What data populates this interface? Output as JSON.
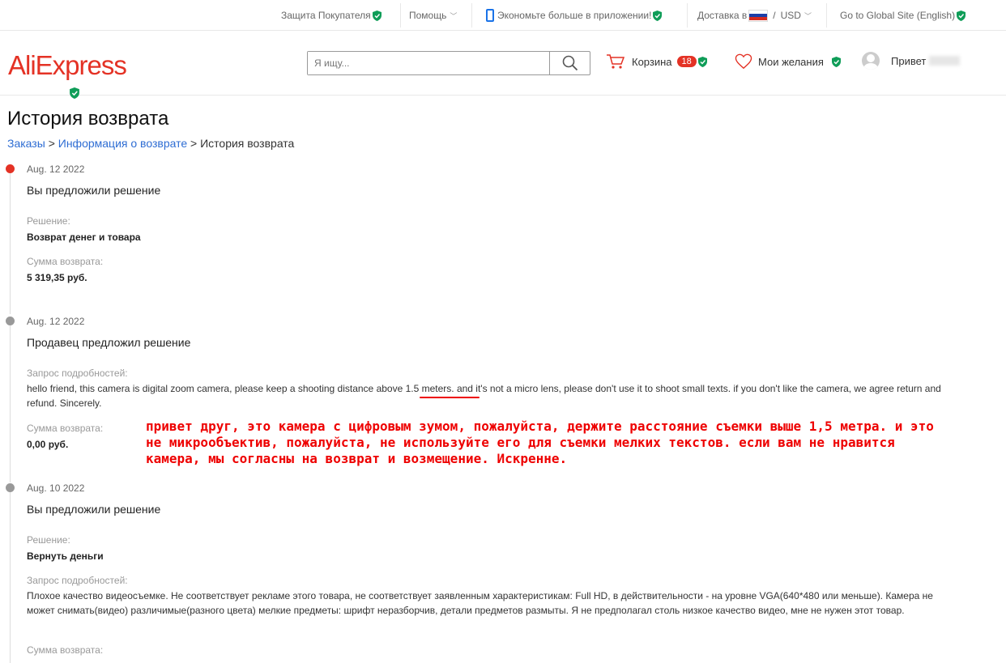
{
  "topbar": {
    "buyer_protection": "Защита Покупателя",
    "help": "Помощь",
    "app_promo": "Экономьте больше в приложении!",
    "ship_to": "Доставка в",
    "currency": "USD",
    "global_site": "Go to Global Site (English)"
  },
  "header": {
    "logo": "AliExpress",
    "search_placeholder": "Я ищу...",
    "cart_label": "Корзина",
    "cart_count": "18",
    "wishlist_label": "Мои желания",
    "greeting": "Привет"
  },
  "page": {
    "title": "История возврата",
    "breadcrumb": [
      "Заказы",
      "Информация о возврате",
      "История возврата"
    ],
    "breadcrumb_sep": ">"
  },
  "timeline": [
    {
      "date": "Aug. 12 2022",
      "heading": "Вы предложили решение",
      "solution_label": "Решение:",
      "solution_value": "Возврат денег и товара",
      "amount_label": "Сумма возврата:",
      "amount_value": "5 319,35 руб."
    },
    {
      "date": "Aug. 12 2022",
      "heading": "Продавец предложил решение",
      "details_label": "Запрос подробностей:",
      "details_text": "hello friend, this camera is digital zoom camera, please keep a shooting distance above 1.5 meters. and it's not a micro lens, please don't use it to shoot small texts. if you don't like the camera, we agree return and refund. Sincerely.",
      "amount_label": "Сумма возврата:",
      "amount_value": "0,00 руб."
    },
    {
      "date": "Aug. 10 2022",
      "heading": "Вы предложили решение",
      "solution_label": "Решение:",
      "solution_value": "Вернуть деньги",
      "details_label": "Запрос подробностей:",
      "details_text": "Плохое качество видеосъемке. Не соответствует рекламе этого товара, не соответствует заявленным характеристикам: Full HD, в действительности - на уровне VGA(640*480 или меньше). Камера не может снимать(видео) различимые(разного цвета) мелкие предметы: шрифт неразборчив, детали предметов размыты. Я не предполагал столь низкое качество видео, мне не нужен этот товар.",
      "amount_label": "Сумма возврата:"
    }
  ],
  "translation_overlay": "привет друг, это камера с цифровым зумом, пожалуйста, держите расстояние съемки выше 1,5 метра. и это не микрообъектив, пожалуйста, не используйте его для съемки мелких текстов. если вам не нравится камера, мы согласны на возврат и возмещение. Искренне.",
  "colors": {
    "brand": "#e43225",
    "link": "#2e6dd3",
    "shield": "#0f9d58",
    "overlay_red": "#e00000"
  }
}
